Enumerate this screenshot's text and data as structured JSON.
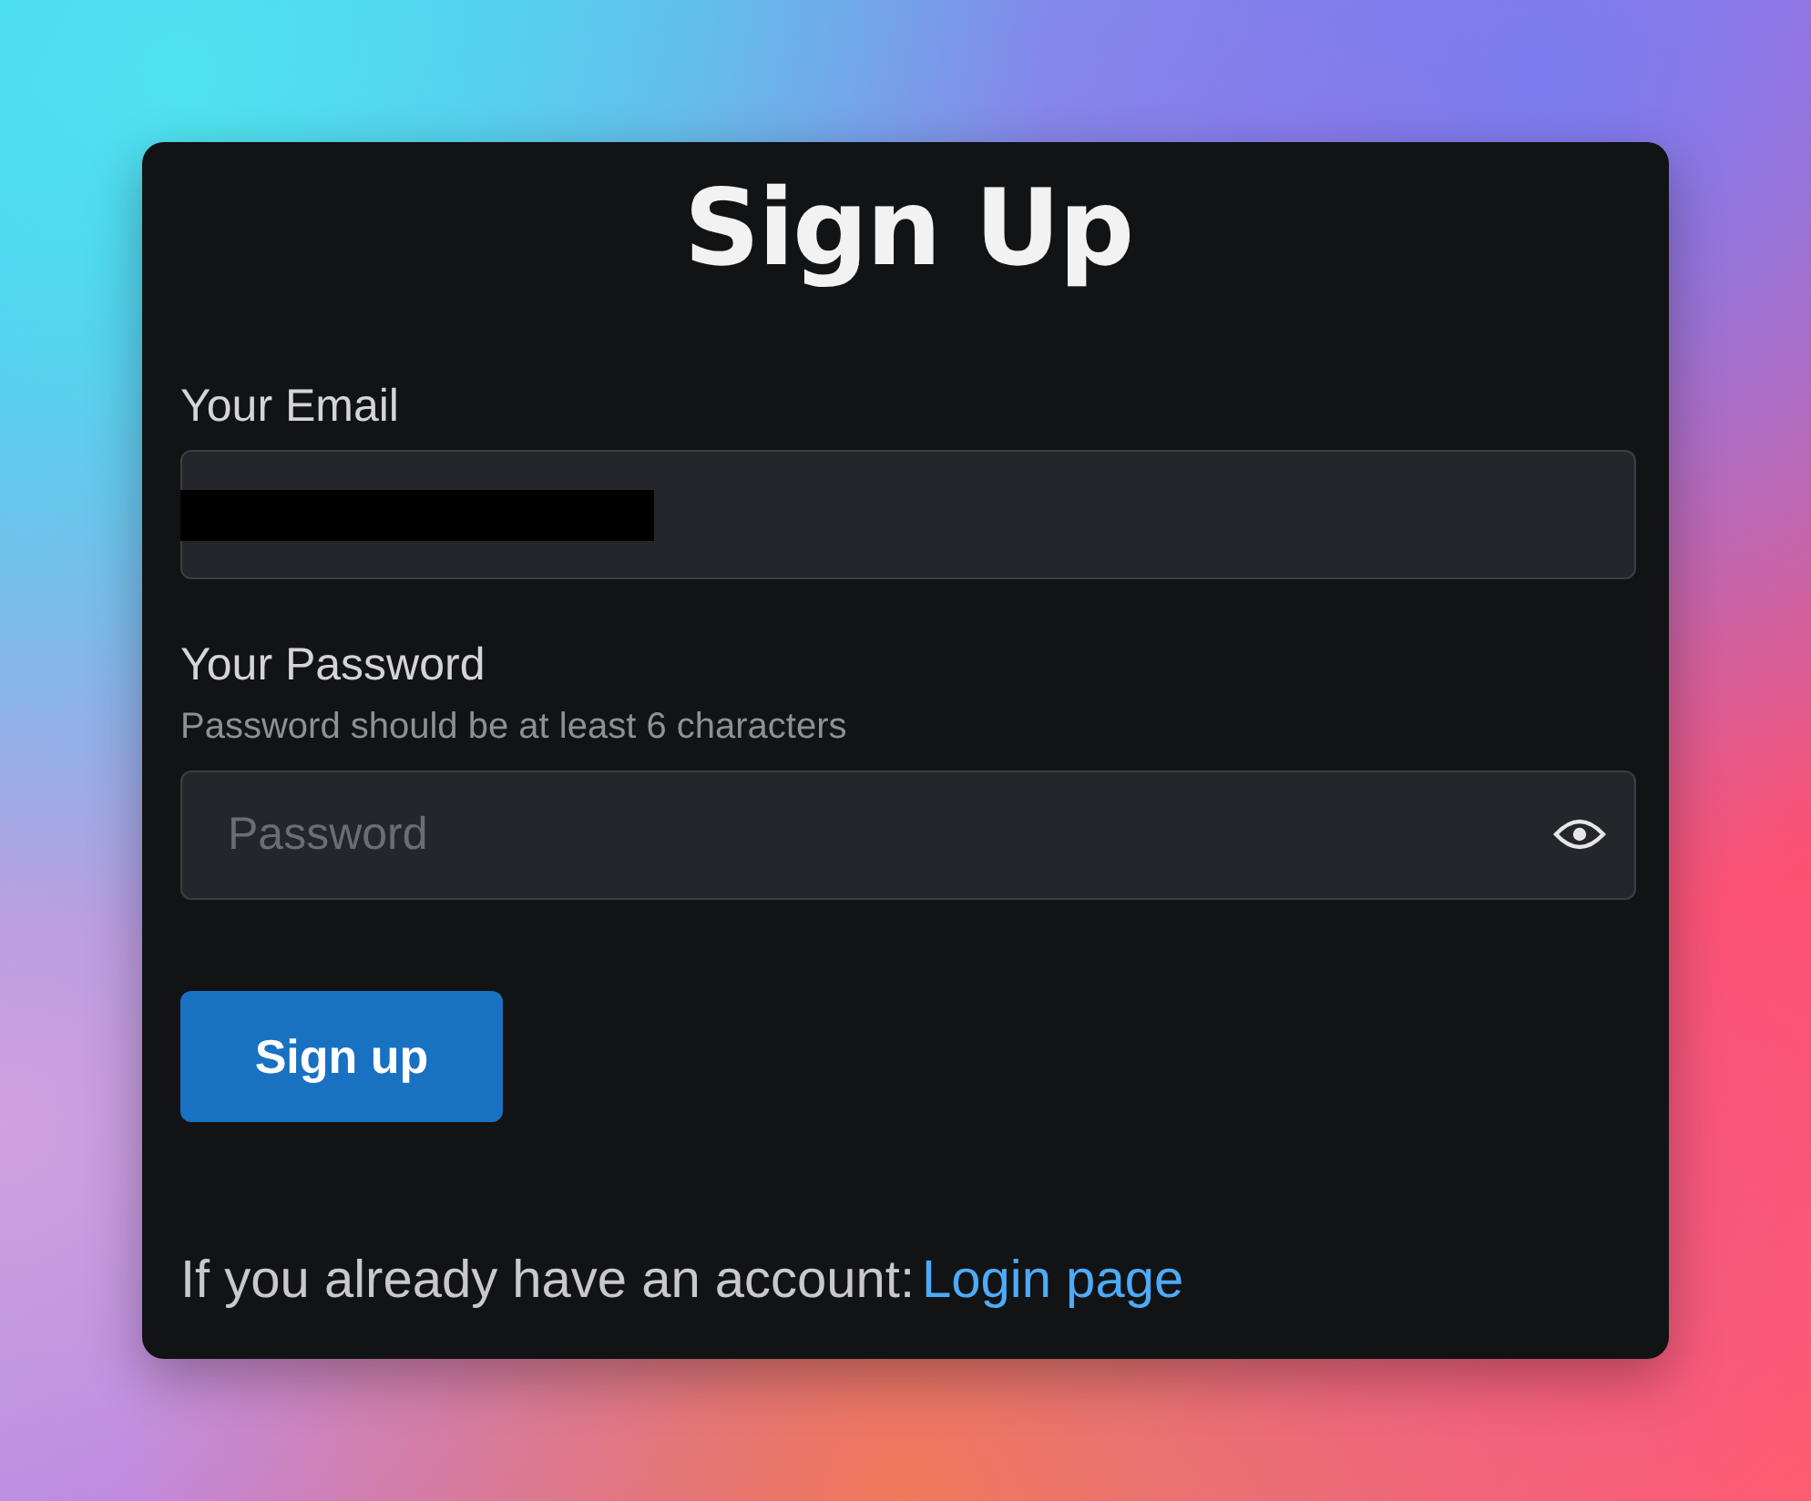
{
  "title": "Sign Up",
  "email": {
    "label": "Your Email",
    "value_redacted": true
  },
  "password": {
    "label": "Your Password",
    "hint": "Password should be at least 6 characters",
    "placeholder": "Password"
  },
  "submit": {
    "label": "Sign up"
  },
  "footer": {
    "text": "If you already have an account:",
    "link": "Login page"
  }
}
